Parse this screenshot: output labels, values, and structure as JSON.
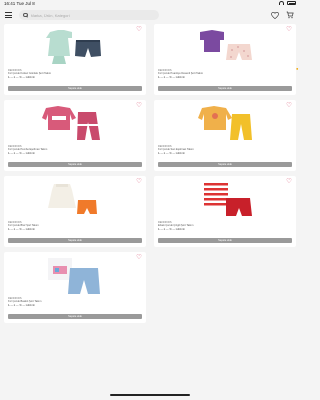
{
  "status": {
    "time": "16:41",
    "date": "Tue Jul 8",
    "battery": ""
  },
  "search": {
    "placeholder": "Marka, Ürün, Kategori"
  },
  "colors": {
    "heart": "#d64a6b",
    "button": "#9a9a9a"
  },
  "products": [
    {
      "brand": "DENOKIDS",
      "name": "Kız Çocuk Kolsuz Gömlek Şort Takım",
      "price": "₺ — ₺ — % — indirimli",
      "button": "Sepete ekle",
      "image": "top-short-mint-set"
    },
    {
      "brand": "DENOKIDS",
      "name": "Kız Çocuk Puantiye Desenli Şort Takım",
      "price": "₺ — ₺ — % — indirimli",
      "button": "Sepete ekle",
      "image": "purple-top-pattern-short"
    },
    {
      "brand": "DENOKIDS",
      "name": "Kız Çocuk Pembe Eşofman Takım",
      "price": "₺ — ₺ — % — indirimli",
      "button": "Sepete ekle",
      "image": "pink-tracksuit"
    },
    {
      "brand": "DENOKIDS",
      "name": "Kız Çocuk Sarı Eşofman Takım",
      "price": "₺ — ₺ — % — indirimli",
      "button": "Sepete ekle",
      "image": "yellow-tracksuit"
    },
    {
      "brand": "DENOKIDS",
      "name": "Kız Çocuk Bluz Şort Takım",
      "price": "₺ — ₺ — % — indirimli",
      "button": "Sepete ekle",
      "image": "white-top-orange-short"
    },
    {
      "brand": "DENOKIDS",
      "name": "Erkek Çocuk Çizgili Şort Takım",
      "price": "₺ — ₺ — % — indirimli",
      "button": "Sepete ekle",
      "image": "striped-tee-red-short"
    },
    {
      "brand": "DENOKIDS",
      "name": "Kız Çocuk Baskılı Şort Takım",
      "price": "₺ — ₺ — % — indirimli",
      "button": "Sepete ekle",
      "image": "print-tee-denim-short"
    }
  ]
}
